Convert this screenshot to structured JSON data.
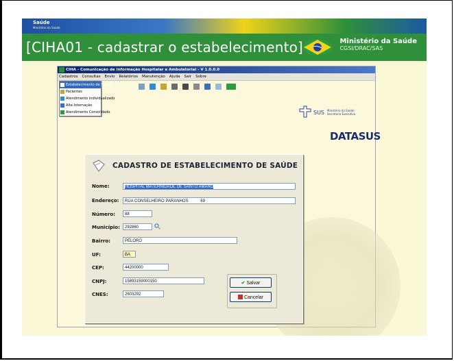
{
  "slide": {
    "header_brand": "Saúde",
    "header_brand_sub": "Ministério da Saúde",
    "title": "[CIHA01 - cadastrar o estabelecimento]",
    "org_name": "Ministério da Saúde",
    "org_sub": "CGSI/DRAC/SAS"
  },
  "app": {
    "title": "CIHA - Comunicação de Informação Hospitalar e Ambulatorial - V 1.0.0.0",
    "menu": [
      "Cadastros",
      "Consultas",
      "Envio",
      "Relatórios",
      "Manutenção",
      "Ajuda",
      "Sair",
      "Sobre"
    ],
    "dropdown": [
      "Estabelecimento de Saúde",
      "Pacientes",
      "Atendimento Individualizado",
      "Alta Internação",
      "Atendimento Consolidado"
    ],
    "isus_label": "SUS",
    "isus_sub": "Ministério da Saúde",
    "isus_sub2": "Secretaria Executiva",
    "datasus": "DATASUS"
  },
  "dialog": {
    "title": "CADASTRO DE ESTABELECIMENTO DE SAÚDE",
    "labels": {
      "nome": "Nome:",
      "endereco": "Endereço:",
      "numero": "Número:",
      "municipio": "Município:",
      "bairro": "Bairro:",
      "uf": "UF:",
      "cep": "CEP:",
      "cnpj": "CNPJ:",
      "cnes": "CNES:"
    },
    "values": {
      "nome": "HOSPITAL MATERNIDADE DE SANTO AMARO",
      "endereco": "RUA CONSELHEIRO PARANHOS",
      "endereco_num": "69",
      "numero": "88",
      "municipio": "292860",
      "bairro": "PELORO",
      "uf": "BA",
      "cep": "44200000",
      "cnpj": "15893159000150",
      "cnes": "2603292"
    },
    "save_label": "Salvar",
    "cancel_label": "Cancelar"
  },
  "colors": {
    "slide_bg": "#fbf8d8",
    "title_bar": "#2f8f3a",
    "selection": "#316ac5"
  }
}
